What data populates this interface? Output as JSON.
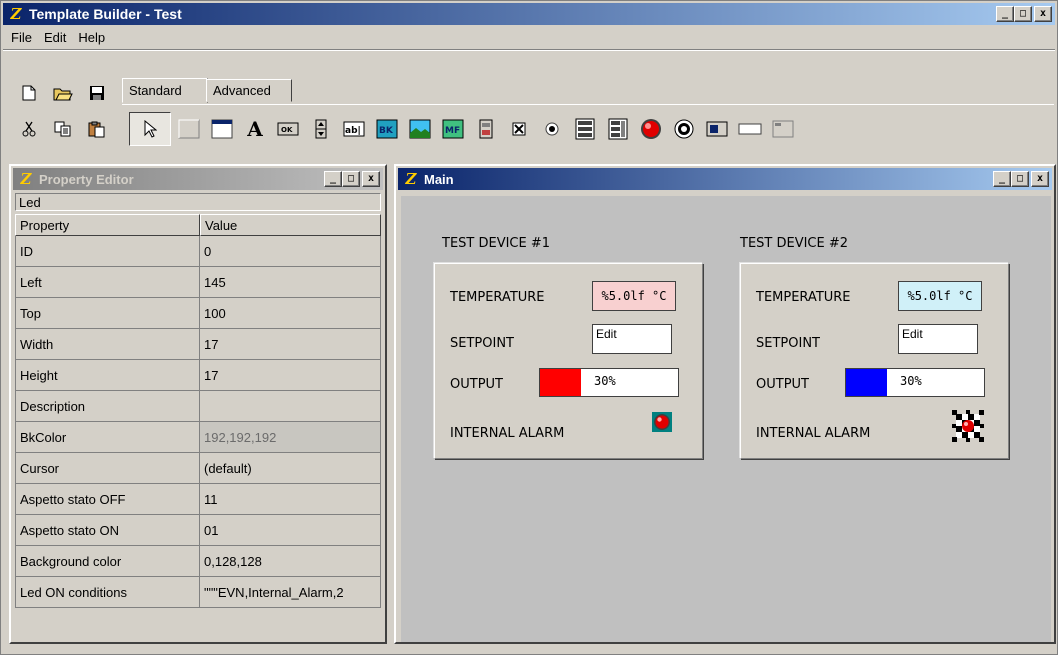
{
  "app": {
    "title": "Template Builder - Test"
  },
  "menu": [
    "File",
    "Edit",
    "Help"
  ],
  "tabs": {
    "standard": "Standard",
    "advanced": "Advanced"
  },
  "property_editor": {
    "title": "Property Editor",
    "object_type": "Led",
    "columns": [
      "Property",
      "Value"
    ],
    "rows": [
      {
        "k": "ID",
        "v": "0"
      },
      {
        "k": "Left",
        "v": "145"
      },
      {
        "k": "Top",
        "v": "100"
      },
      {
        "k": "Width",
        "v": "17"
      },
      {
        "k": "Height",
        "v": "17"
      },
      {
        "k": "Description",
        "v": ""
      },
      {
        "k": "BkColor",
        "v": "192,192,192"
      },
      {
        "k": "Cursor",
        "v": "(default)"
      },
      {
        "k": "Aspetto stato OFF",
        "v": "11"
      },
      {
        "k": "Aspetto stato ON",
        "v": "01"
      },
      {
        "k": "Background color",
        "v": "0,128,128"
      },
      {
        "k": "Led ON conditions",
        "v": "\"\"\"EVN,Internal_Alarm,2"
      }
    ]
  },
  "main_window": {
    "title": "Main"
  },
  "devices": [
    {
      "title": "TEST DEVICE #1",
      "temperature_label": "TEMPERATURE",
      "temperature_value": "%5.0lf °C",
      "temperature_bg": "#f8d0d0",
      "setpoint_label": "SETPOINT",
      "setpoint_value": "Edit",
      "output_label": "OUTPUT",
      "output_value": "30%",
      "output_fraction": 0.3,
      "output_color": "#ff0000",
      "alarm_label": "INTERNAL ALARM"
    },
    {
      "title": "TEST DEVICE #2",
      "temperature_label": "TEMPERATURE",
      "temperature_value": "%5.0lf °C",
      "temperature_bg": "#d0f0f8",
      "setpoint_label": "SETPOINT",
      "setpoint_value": "Edit",
      "output_label": "OUTPUT",
      "output_value": "30%",
      "output_fraction": 0.3,
      "output_color": "#0000ff",
      "alarm_label": "INTERNAL ALARM"
    }
  ],
  "colors": {
    "title_active": "#0a246a",
    "title_inactive": "#808080",
    "face": "#d4d0c8"
  }
}
